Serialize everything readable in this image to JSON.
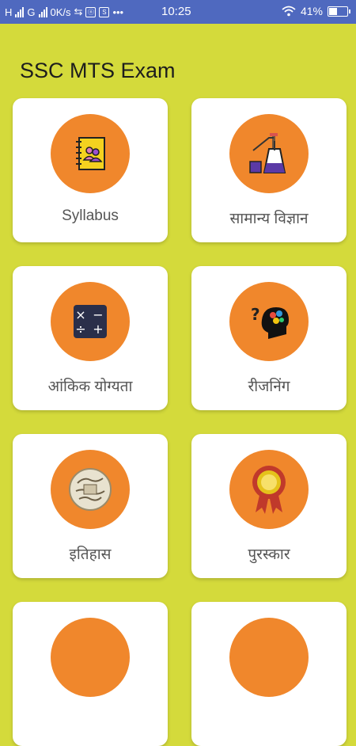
{
  "status_bar": {
    "network_h": "H",
    "network_g": "G",
    "speed": "0K/s",
    "notification_icon_a": "ⓝ",
    "notification_icon_b": "S",
    "overflow": "•••",
    "time": "10:25",
    "battery_percent": "41%"
  },
  "app": {
    "title": "SSC MTS Exam"
  },
  "cards": [
    {
      "label": "Syllabus",
      "icon": "syllabus-book-icon"
    },
    {
      "label": "सामान्य विज्ञान",
      "icon": "science-lab-icon"
    },
    {
      "label": "आंकिक योग्यता",
      "icon": "calculator-icon"
    },
    {
      "label": "रीजनिंग",
      "icon": "brain-reasoning-icon"
    },
    {
      "label": "इतिहास",
      "icon": "history-scroll-icon"
    },
    {
      "label": "पुरस्कार",
      "icon": "award-ribbon-icon"
    }
  ],
  "colors": {
    "background": "#d4da3b",
    "status_bar": "#4f69bf",
    "circle": "#f0872c",
    "card": "#ffffff"
  }
}
